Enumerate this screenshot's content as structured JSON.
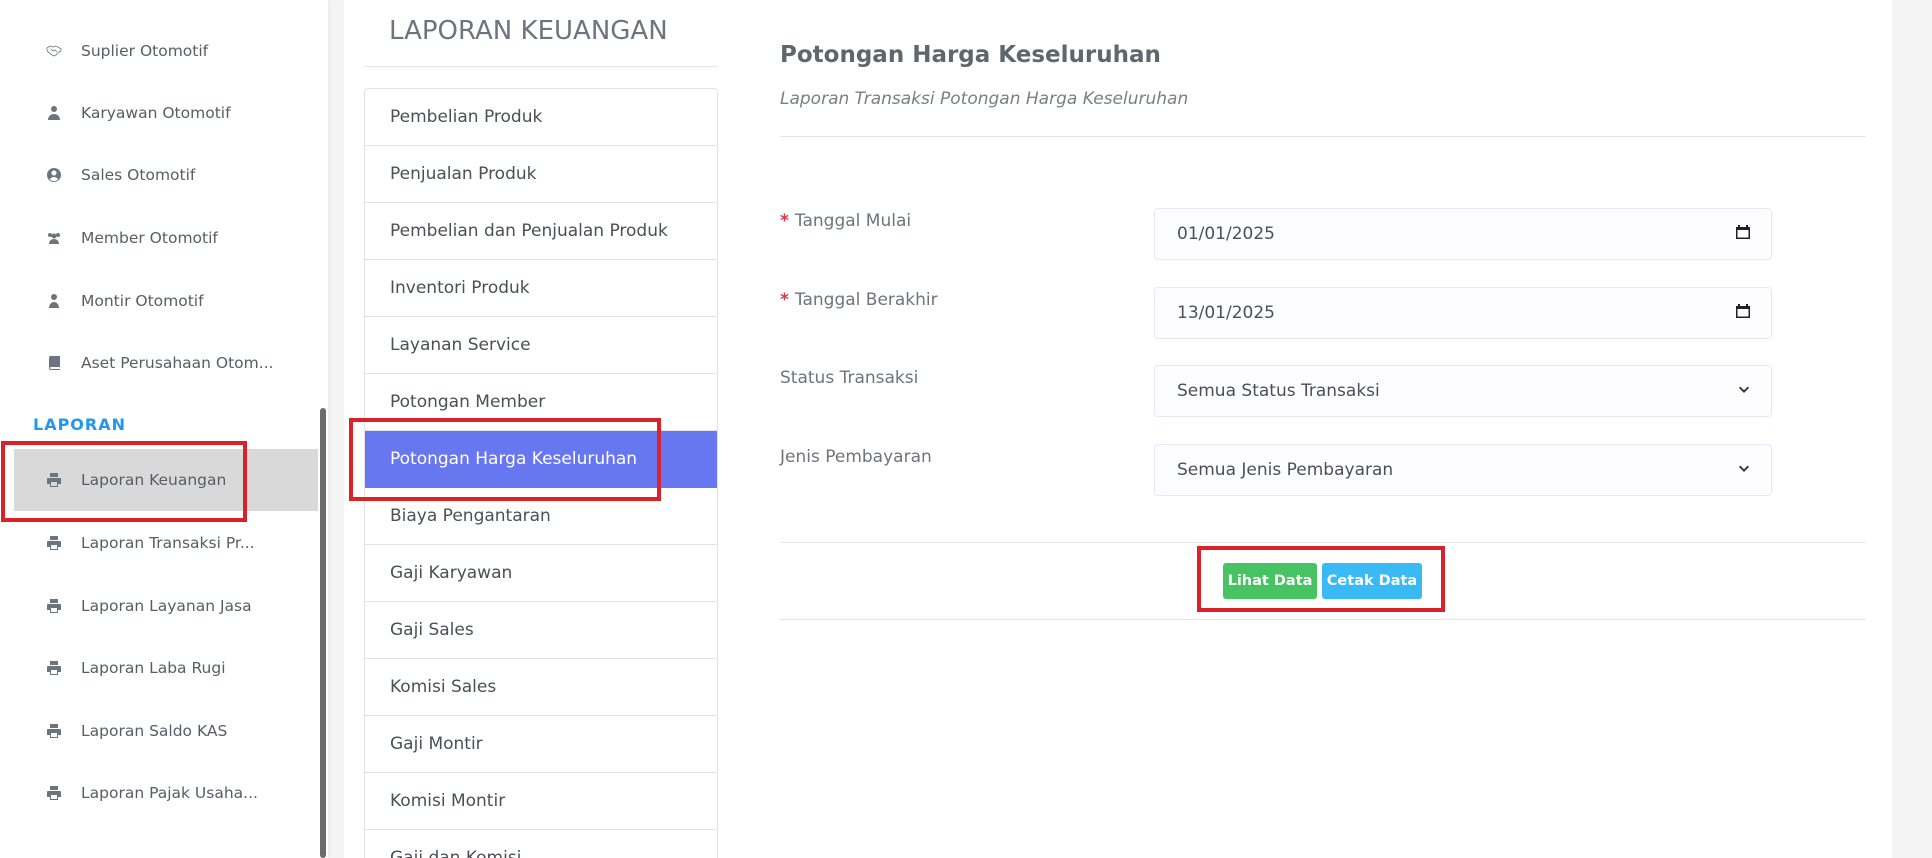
{
  "sidebar": {
    "items_top": [
      {
        "label": "Suplier Otomotif",
        "icon": "handshake-icon"
      },
      {
        "label": "Karyawan Otomotif",
        "icon": "user-tie-icon"
      },
      {
        "label": "Sales Otomotif",
        "icon": "user-circle-icon"
      },
      {
        "label": "Member Otomotif",
        "icon": "users-icon"
      },
      {
        "label": "Montir Otomotif",
        "icon": "user-icon"
      },
      {
        "label": "Aset Perusahaan Otom...",
        "icon": "book-icon"
      }
    ],
    "section_heading": "LAPORAN",
    "items_laporan": [
      {
        "label": "Laporan Keuangan",
        "icon": "print-icon"
      },
      {
        "label": "Laporan Transaksi Pr...",
        "icon": "print-icon"
      },
      {
        "label": "Laporan Layanan Jasa",
        "icon": "print-icon"
      },
      {
        "label": "Laporan Laba Rugi",
        "icon": "print-icon"
      },
      {
        "label": "Laporan Saldo KAS",
        "icon": "print-icon"
      },
      {
        "label": "Laporan Pajak Usaha...",
        "icon": "print-icon"
      }
    ]
  },
  "report": {
    "title": "LAPORAN KEUANGAN",
    "items": [
      "Pembelian Produk",
      "Penjualan Produk",
      "Pembelian dan Penjualan Produk",
      "Inventori Produk",
      "Layanan Service",
      "Potongan Member",
      "Potongan Harga Keseluruhan",
      "Biaya Pengantaran",
      "Gaji Karyawan",
      "Gaji Sales",
      "Komisi Sales",
      "Gaji Montir",
      "Komisi Montir",
      "Gaji dan Komisi"
    ],
    "active_item": "Potongan Harga Keseluruhan"
  },
  "form": {
    "title": "Potongan Harga Keseluruhan",
    "subtitle": "Laporan Transaksi Potongan Harga Keseluruhan",
    "required_marker": "*",
    "tanggal_mulai_label": "Tanggal Mulai",
    "tanggal_mulai_value": "01/01/2025",
    "tanggal_berakhir_label": "Tanggal Berakhir",
    "tanggal_berakhir_value": "13/01/2025",
    "status_label": "Status Transaksi",
    "status_value": "Semua Status Transaksi",
    "jenis_label": "Jenis Pembayaran",
    "jenis_value": "Semua Jenis Pembayaran",
    "lihat_button": "Lihat Data",
    "cetak_button": "Cetak Data"
  },
  "colors": {
    "accent": "#6777ef",
    "heading": "#2196f3",
    "success": "#47c363",
    "info": "#3abaf4",
    "highlight": "#d9222a",
    "required": "#dc3545"
  }
}
